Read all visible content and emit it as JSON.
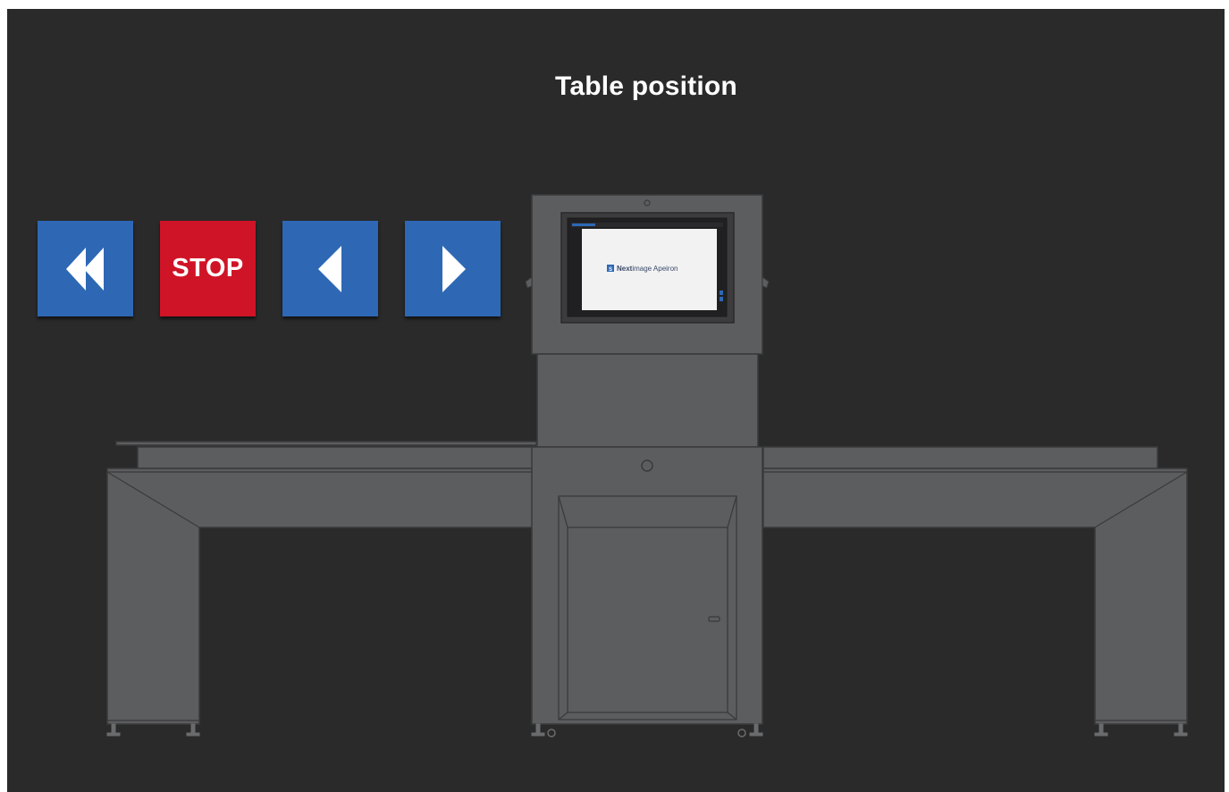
{
  "page": {
    "title": "Table position"
  },
  "controls": {
    "fast_back_icon": "double-chevron-left-icon",
    "stop_label": "STOP",
    "back_icon": "triangle-left-icon",
    "forward_icon": "triangle-right-icon"
  },
  "machine": {
    "screen_brand": "Nextimage Apeiron",
    "screen_brand_bold": "Next",
    "screen_brand_rest": "image Apeiron",
    "screen_logo_letter": "S"
  },
  "colors": {
    "background": "#2a2a2a",
    "button_blue": "#2e68b5",
    "button_red": "#d01427",
    "machine_fill": "#5c5d5f",
    "machine_stroke": "#3a3a3b"
  }
}
